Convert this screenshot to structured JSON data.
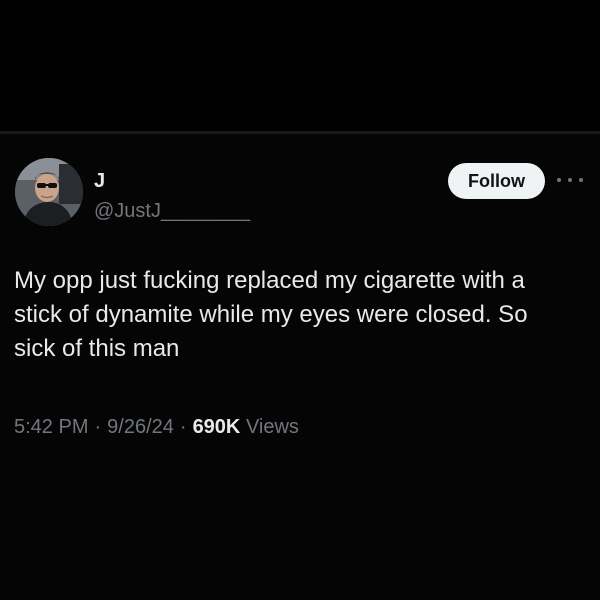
{
  "author": {
    "display_name": "J",
    "handle": "@JustJ________"
  },
  "actions": {
    "follow_label": "Follow",
    "more_icon": "more-horizontal-icon"
  },
  "tweet": {
    "text": "My opp just fucking replaced my cigarette with a\nstick of dynamite while my eyes were closed. So\nsick of this man"
  },
  "meta": {
    "time": "5:42 PM",
    "date": "9/26/24",
    "separator": "·",
    "views_count": "690K",
    "views_label": "Views"
  },
  "colors": {
    "background": "#000000",
    "primary_text": "#e7e9ea",
    "secondary_text": "#71767b",
    "follow_button_bg": "#eff3f4",
    "follow_button_text": "#0f1419"
  }
}
